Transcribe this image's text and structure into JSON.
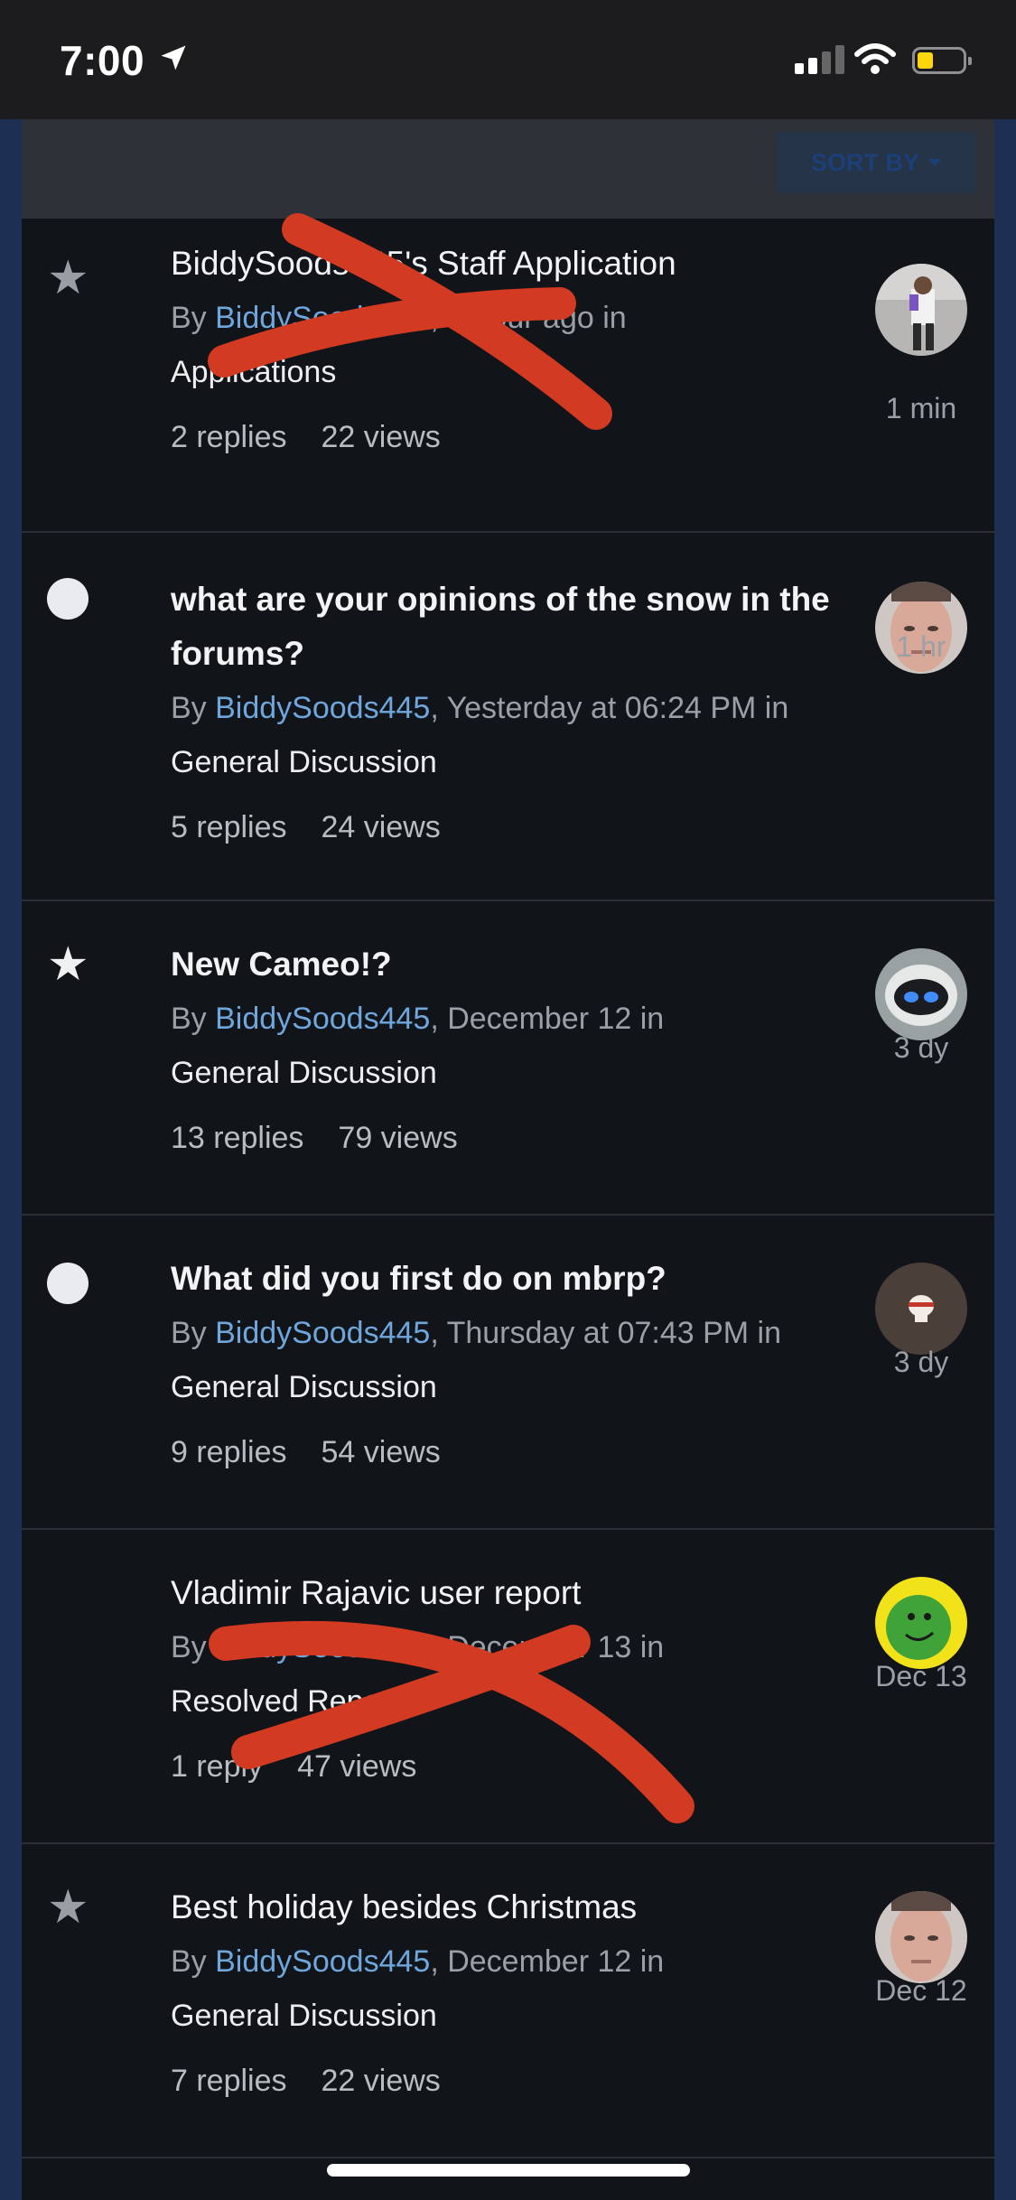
{
  "status_bar": {
    "time": "7:00"
  },
  "sort": {
    "label": "SORT BY"
  },
  "topics": [
    {
      "title": "BiddySoods445's Staff Application",
      "by": "By ",
      "author": "BiddySoods445",
      "when": ", 1 hour ago in",
      "forum": "Applications",
      "replies": "2 replies",
      "views": "22 views",
      "last": "1 min",
      "marker": "star-grey",
      "title_bold": false
    },
    {
      "title": "what are your opinions of the snow in the forums?",
      "by": "By ",
      "author": "BiddySoods445",
      "when": ", Yesterday at 06:24 PM in",
      "forum": "General Discussion",
      "replies": "5 replies",
      "views": "24 views",
      "last": "1 hr",
      "marker": "dot",
      "title_bold": true
    },
    {
      "title": "New Cameo!?",
      "by": "By ",
      "author": "BiddySoods445",
      "when": ", December 12 in",
      "forum": "General Discussion",
      "replies": "13 replies",
      "views": "79 views",
      "last": "3 dy",
      "marker": "star-white",
      "title_bold": true
    },
    {
      "title": "What did you first do on mbrp?",
      "by": "By ",
      "author": "BiddySoods445",
      "when": ", Thursday at 07:43 PM in",
      "forum": "General Discussion",
      "replies": "9 replies",
      "views": "54 views",
      "last": "3 dy",
      "marker": "dot",
      "title_bold": true
    },
    {
      "title": "Vladimir Rajavic user report",
      "by": "By ",
      "author": "BiddySoods445",
      "when": ", December 13 in",
      "forum": "Resolved Reports",
      "replies": "1 reply",
      "views": "47 views",
      "last": "Dec 13",
      "marker": "none",
      "title_bold": false
    },
    {
      "title": "Best holiday besides Christmas",
      "by": "By ",
      "author": "BiddySoods445",
      "when": ", December 12 in",
      "forum": "General Discussion",
      "replies": "7 replies",
      "views": "22 views",
      "last": "Dec 12",
      "marker": "star-grey",
      "title_bold": false
    }
  ],
  "colors": {
    "author_link": "#6fa7dc",
    "background": "#111419",
    "scribble": "#d23a22"
  }
}
